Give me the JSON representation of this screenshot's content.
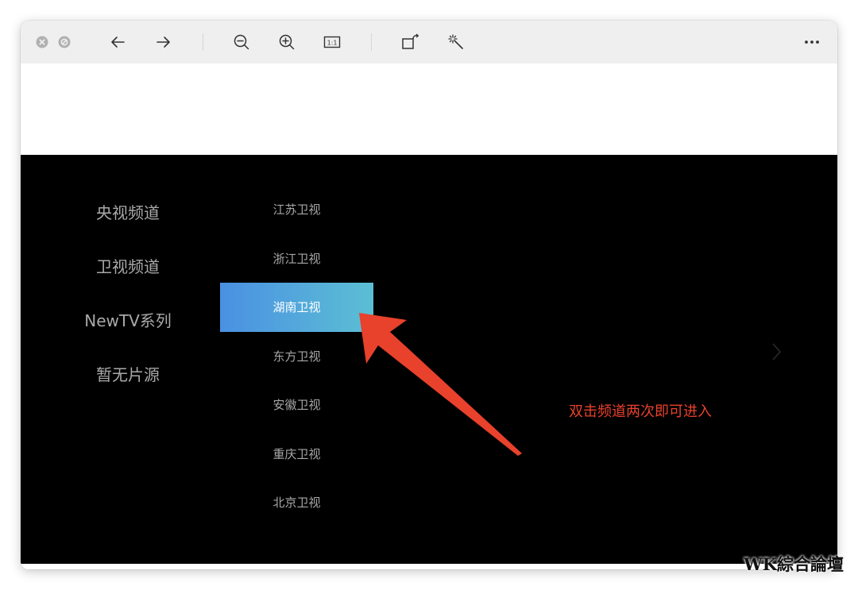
{
  "toolbar": {
    "icons": [
      "close-icon",
      "minimize-icon",
      "arrow-left-icon",
      "arrow-right-icon",
      "zoom-out-icon",
      "zoom-in-icon",
      "actual-size-icon",
      "rotate-icon",
      "magic-wand-icon",
      "more-icon"
    ],
    "actual_size_label": "1:1"
  },
  "tv": {
    "categories": [
      "央视频道",
      "卫视频道",
      "NewTV系列",
      "暂无片源"
    ],
    "channels": [
      "江苏卫视",
      "浙江卫视",
      "湖南卫视",
      "东方卫视",
      "安徽卫视",
      "重庆卫视",
      "北京卫视"
    ],
    "selected_channel": "湖南卫视",
    "hint": "双击频道两次即可进入",
    "colors": {
      "selected_gradient_start": "#4a90e2",
      "selected_gradient_end": "#5cbfd4",
      "hint": "#e8412c",
      "arrow": "#e8412c"
    }
  },
  "watermark": "WK綜合論壇"
}
